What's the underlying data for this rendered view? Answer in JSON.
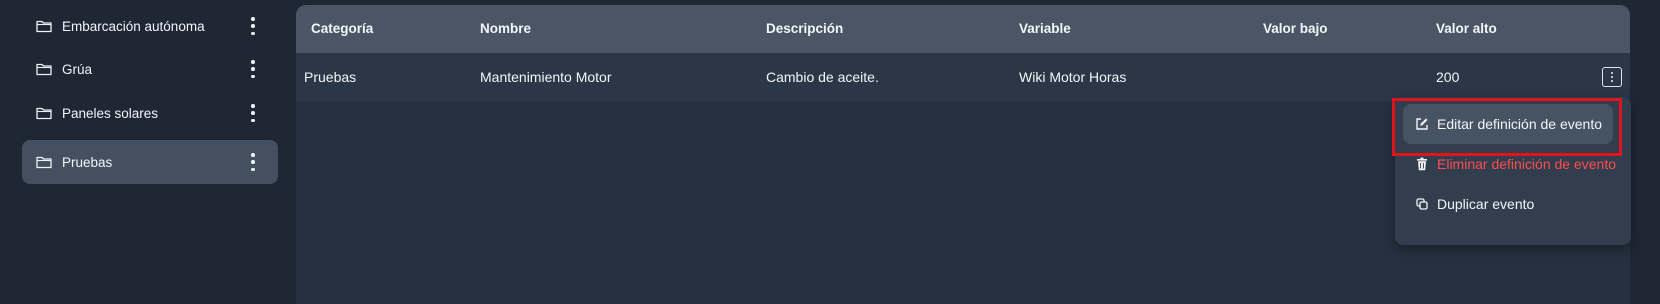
{
  "sidebar": {
    "items": [
      {
        "label": "Embarcación autónoma",
        "active": false
      },
      {
        "label": "Grúa",
        "active": false
      },
      {
        "label": "Paneles solares",
        "active": false
      },
      {
        "label": "Pruebas",
        "active": true
      }
    ]
  },
  "table": {
    "headers": [
      "Categoría",
      "Nombre",
      "Descripción",
      "Variable",
      "Valor bajo",
      "Valor alto"
    ],
    "rows": [
      [
        "Pruebas",
        "Mantenimiento Motor",
        "Cambio de aceite.",
        "Wiki Motor Horas",
        "",
        "200"
      ]
    ]
  },
  "context_menu": {
    "items": [
      {
        "label": "Editar definición de evento",
        "icon": "edit-icon"
      },
      {
        "label": "Eliminar definición de evento",
        "icon": "trash-icon",
        "color": "#ff4c4c"
      },
      {
        "label": "Duplicar evento",
        "icon": "copy-icon"
      }
    ]
  },
  "colors": {
    "highlight": "#e0151c",
    "danger": "#ff4c4c",
    "active_item": "#44505f"
  }
}
